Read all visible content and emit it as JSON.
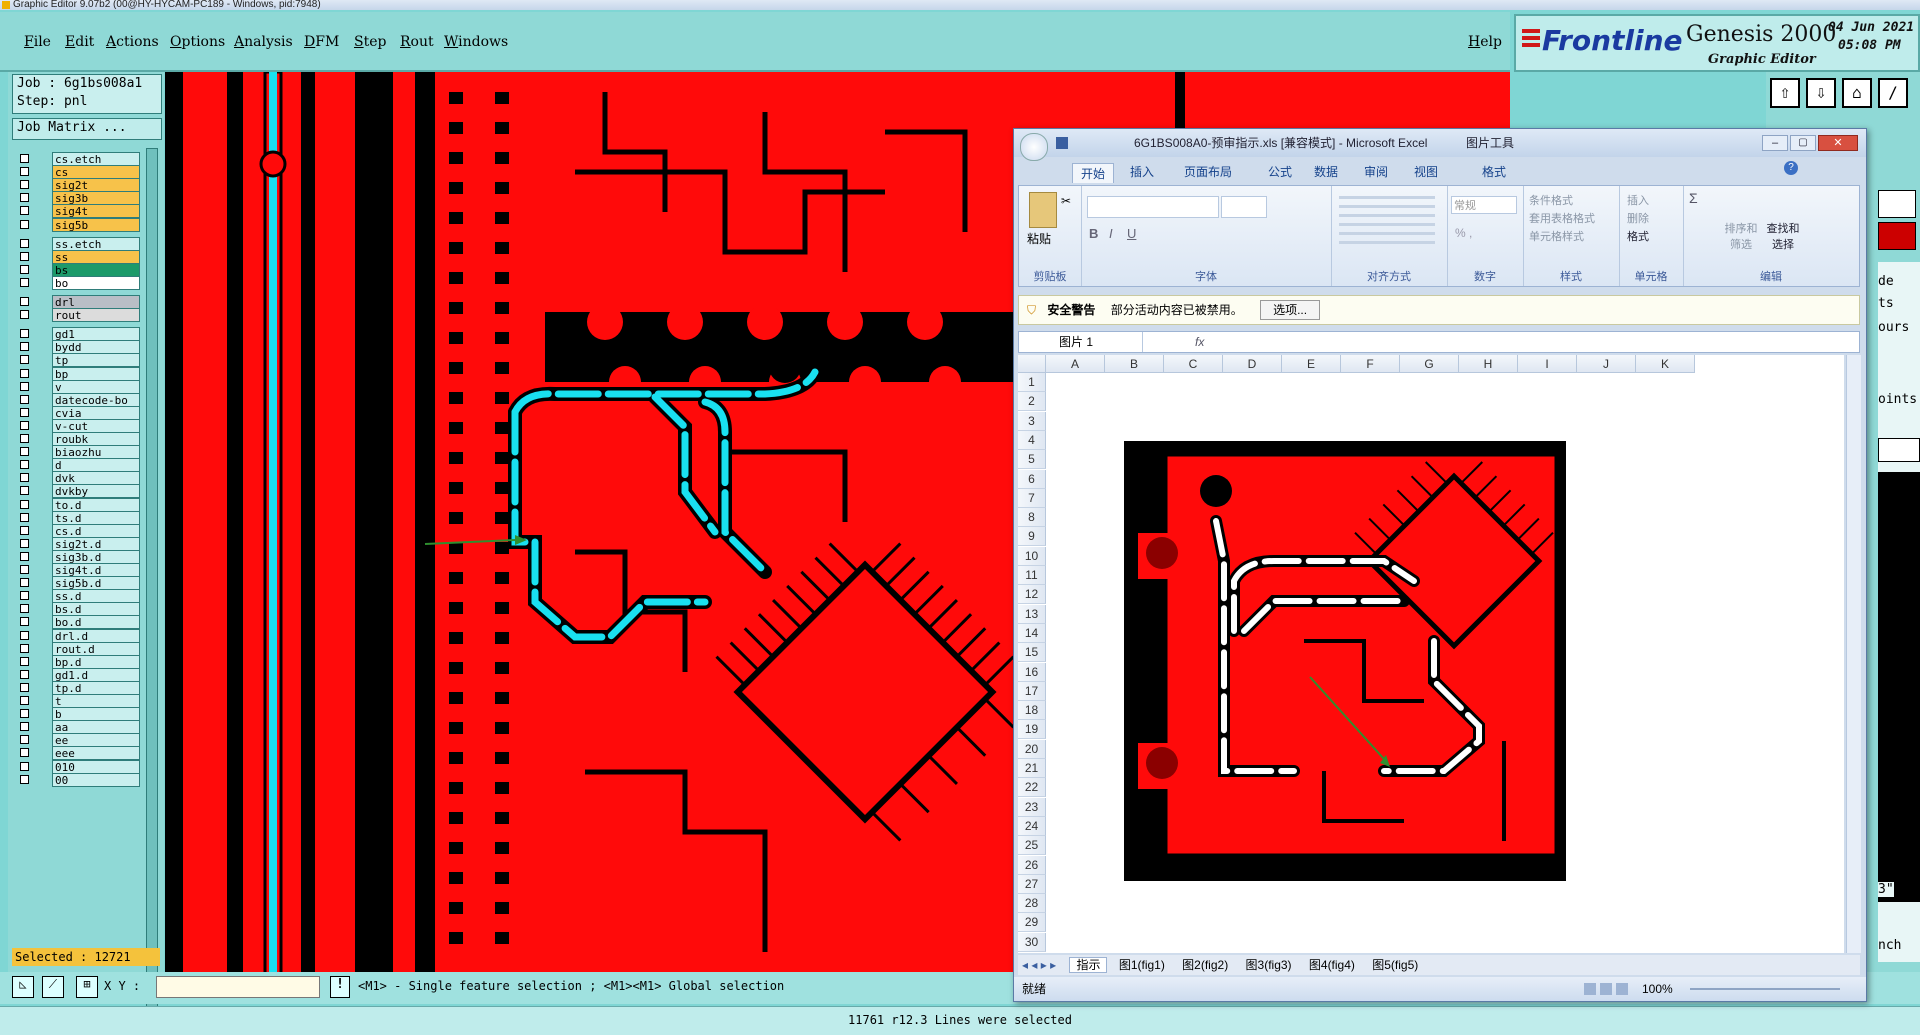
{
  "window": {
    "title": "Graphic Editor 9.07b2 (00@HY-HYCAM-PC189 - Windows, pid:7948)"
  },
  "menu": {
    "items": [
      "File",
      "Edit",
      "Actions",
      "Options",
      "Analysis",
      "DFM",
      "Step",
      "Rout",
      "Windows"
    ],
    "help": "Help"
  },
  "brand": {
    "logo": "Frontline",
    "product": "Genesis 2000",
    "subtitle": "Graphic Editor",
    "date": "04 Jun 2021",
    "time": "05:08 PM"
  },
  "job": {
    "job_label": "Job : 6g1bs008a1",
    "step_label": "Step: pnl",
    "matrix_button": "Job Matrix ..."
  },
  "layers": [
    {
      "name": "cs.etch",
      "color": "#c9efee"
    },
    {
      "name": "cs",
      "color": "#f7c24a"
    },
    {
      "name": "sig2t",
      "color": "#f7c24a"
    },
    {
      "name": "sig3b",
      "color": "#f7c24a"
    },
    {
      "name": "sig4t",
      "color": "#f7c24a"
    },
    {
      "name": "sig5b",
      "color": "#f7c24a"
    },
    {
      "name": "ss.etch",
      "color": "#c9efee"
    },
    {
      "name": "ss",
      "color": "#f7c24a"
    },
    {
      "name": "bs",
      "color": "#1c9a6a"
    },
    {
      "name": "bo",
      "color": "#ffffff"
    },
    {
      "name": "drl",
      "color": "#b9bec6"
    },
    {
      "name": "rout",
      "color": "#dcdcdc"
    },
    {
      "name": "gd1",
      "color": "#c9efee"
    },
    {
      "name": "bydd",
      "color": "#c9efee"
    },
    {
      "name": "tp",
      "color": "#c9efee"
    },
    {
      "name": "bp",
      "color": "#c9efee"
    },
    {
      "name": "v",
      "color": "#c9efee"
    },
    {
      "name": "datecode-bo",
      "color": "#c9efee"
    },
    {
      "name": "cvia",
      "color": "#c9efee"
    },
    {
      "name": "v-cut",
      "color": "#c9efee"
    },
    {
      "name": "roubk",
      "color": "#c9efee"
    },
    {
      "name": "biaozhu",
      "color": "#c9efee"
    },
    {
      "name": "d",
      "color": "#c9efee"
    },
    {
      "name": "dvk",
      "color": "#c9efee"
    },
    {
      "name": "dvkby",
      "color": "#c9efee"
    },
    {
      "name": "to.d",
      "color": "#c9efee"
    },
    {
      "name": "ts.d",
      "color": "#c9efee"
    },
    {
      "name": "cs.d",
      "color": "#c9efee"
    },
    {
      "name": "sig2t.d",
      "color": "#c9efee"
    },
    {
      "name": "sig3b.d",
      "color": "#c9efee"
    },
    {
      "name": "sig4t.d",
      "color": "#c9efee"
    },
    {
      "name": "sig5b.d",
      "color": "#c9efee"
    },
    {
      "name": "ss.d",
      "color": "#c9efee"
    },
    {
      "name": "bs.d",
      "color": "#c9efee"
    },
    {
      "name": "bo.d",
      "color": "#c9efee"
    },
    {
      "name": "drl.d",
      "color": "#c9efee"
    },
    {
      "name": "rout.d",
      "color": "#c9efee"
    },
    {
      "name": "bp.d",
      "color": "#c9efee"
    },
    {
      "name": "gd1.d",
      "color": "#c9efee"
    },
    {
      "name": "tp.d",
      "color": "#c9efee"
    },
    {
      "name": "t",
      "color": "#c9efee"
    },
    {
      "name": "b",
      "color": "#c9efee"
    },
    {
      "name": "aa",
      "color": "#c9efee"
    },
    {
      "name": "ee",
      "color": "#c9efee"
    },
    {
      "name": "eee",
      "color": "#c9efee"
    },
    {
      "name": "010",
      "color": "#c9efee"
    },
    {
      "name": "00",
      "color": "#c9efee"
    }
  ],
  "selected_label": "Selected : 12721",
  "status": {
    "xy_label": "X Y :",
    "hint": "<M1> - Single feature selection ; <M1><M1> Global selection",
    "message": "11761 r12.3 Lines were selected"
  },
  "right_panel": {
    "labels": [
      "de",
      "ts",
      "ours",
      "oints",
      "3\"",
      "nch"
    ]
  },
  "colors": {
    "copper": "#ff0a0a",
    "background": "#000000",
    "selection": "#19e0f0",
    "panel": "#8fd9d6"
  },
  "excel": {
    "title": "6G1BS008A0-预审指示.xls [兼容模式] - Microsoft Excel",
    "tool_context": "图片工具",
    "tabs": [
      "开始",
      "插入",
      "页面布局",
      "公式",
      "数据",
      "审阅",
      "视图",
      "格式"
    ],
    "groups": [
      "剪贴板",
      "字体",
      "对齐方式",
      "数字",
      "样式",
      "单元格",
      "编辑"
    ],
    "paste": "粘贴",
    "number_format": "常规",
    "style_buttons": [
      "条件格式",
      "套用表格格式",
      "单元格样式"
    ],
    "cell_buttons": [
      "插入",
      "删除",
      "格式"
    ],
    "edit_buttons": [
      "排序和筛选",
      "查找和选择"
    ],
    "warning_title": "安全警告",
    "warning_text": "部分活动内容已被禁用。",
    "warning_button": "选项...",
    "name_box": "图片 1",
    "fx": "fx",
    "columns": [
      "A",
      "B",
      "C",
      "D",
      "E",
      "F",
      "G",
      "H",
      "I",
      "J",
      "K"
    ],
    "rows": [
      "1",
      "2",
      "3",
      "4",
      "5",
      "6",
      "7",
      "8",
      "9",
      "10",
      "11",
      "12",
      "13",
      "14",
      "15",
      "16",
      "17",
      "18",
      "19",
      "20",
      "21",
      "22",
      "23",
      "24",
      "25",
      "26",
      "27",
      "28",
      "29",
      "30"
    ],
    "sheets": [
      "指示",
      "图1(fig1)",
      "图2(fig2)",
      "图3(fig3)",
      "图4(fig4)",
      "图5(fig5)"
    ],
    "status_ready": "就绪",
    "zoom": "100%"
  }
}
